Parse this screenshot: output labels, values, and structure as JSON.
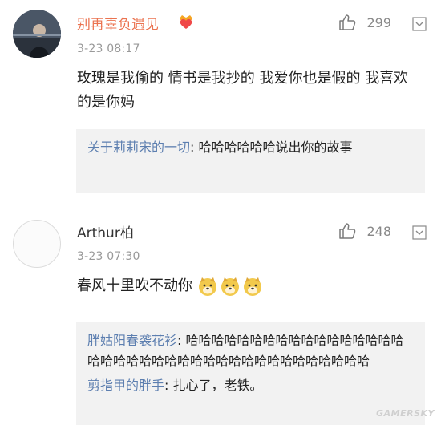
{
  "comments": [
    {
      "username": "别再辜负遇见",
      "time": "3-23 08:17",
      "likes": "299",
      "text": "玫瑰是我偷的 情书是我抄的 我爱你也是假的 我喜欢的是你妈",
      "replies": [
        {
          "name": "关于莉莉宋的一切",
          "text": ": 哈哈哈哈哈哈说出你的故事"
        }
      ]
    },
    {
      "username": "Arthur柏",
      "time": "3-23 07:30",
      "likes": "248",
      "text": "春风十里吹不动你",
      "replies": [
        {
          "name": "胖姑阳春袭花衫",
          "text": ": 哈哈哈哈哈哈哈哈哈哈哈哈哈哈哈哈哈哈哈哈哈哈哈哈哈哈哈哈哈哈哈哈哈哈哈哈哈哈哈"
        },
        {
          "name": "剪指甲的胖手",
          "text": ": 扎心了，老铁。"
        }
      ]
    }
  ],
  "watermark": "GAMERSKY",
  "icons": {
    "like": "thumbs-up-icon",
    "more": "chevron-down-icon",
    "badge": "crown-heart-icon",
    "emoji": "doge-emoji"
  },
  "colors": {
    "username_orange": "#eb7350",
    "reply_link_blue": "#5d7fb0",
    "reply_bg": "#f2f2f2",
    "meta_gray": "#999999"
  }
}
